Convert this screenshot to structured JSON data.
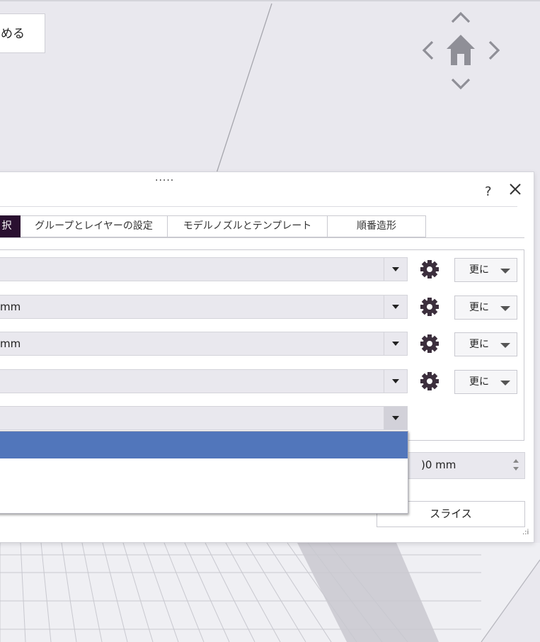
{
  "viewport": {
    "tooltip_text": "める",
    "nav_icons": [
      "chevron-up-icon",
      "chevron-left-icon",
      "home-icon",
      "chevron-right-icon",
      "chevron-down-icon"
    ]
  },
  "dialog": {
    "drag_handle": "·····",
    "help_label": "?",
    "close_icon": "close-icon",
    "tabs": [
      {
        "label": "択",
        "active": true
      },
      {
        "label": "グループとレイヤーの設定",
        "active": false
      },
      {
        "label": "モデルノズルとテンプレート",
        "active": false
      },
      {
        "label": "順番造形",
        "active": false
      }
    ],
    "rows": [
      {
        "value": "",
        "more_label": "更に"
      },
      {
        "value": "mm",
        "more_label": "更に"
      },
      {
        "value": "mm",
        "more_label": "更に"
      },
      {
        "value": "",
        "more_label": "更に"
      }
    ],
    "open_select_value": "",
    "dropdown_options": [
      "",
      ""
    ],
    "spin_value": ")0 mm",
    "slice_label": "スライス",
    "resize_grip": ".:i"
  },
  "colors": {
    "active_tab": "#2a1030",
    "highlight": "#5176bb",
    "background": "#e9e8ee"
  }
}
